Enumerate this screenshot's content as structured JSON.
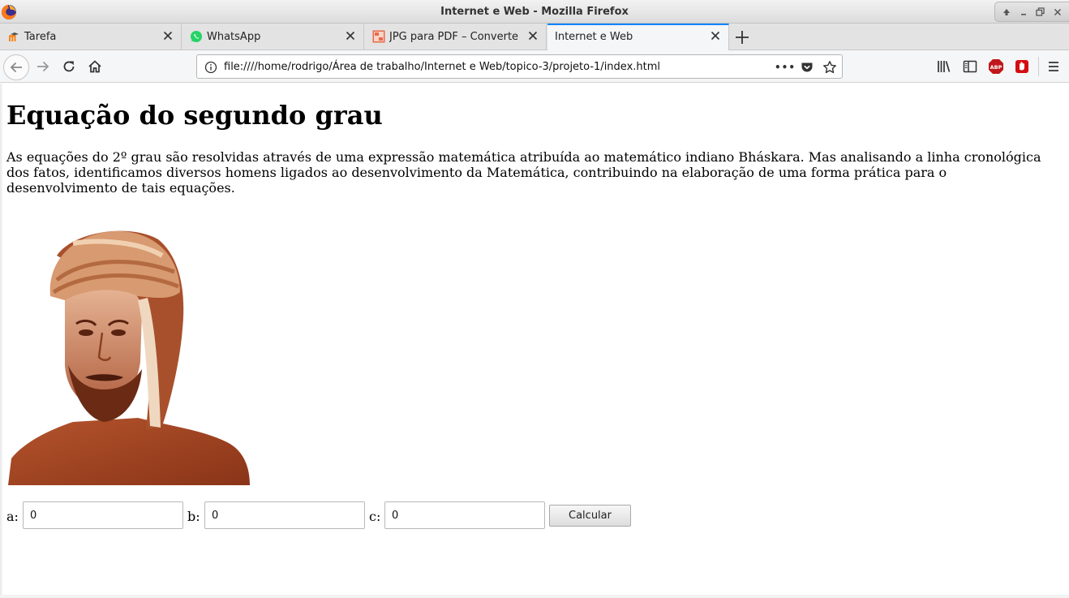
{
  "window": {
    "title": "Internet e Web - Mozilla Firefox"
  },
  "tabs": [
    {
      "label": "Tarefa",
      "icon": "moodle-icon"
    },
    {
      "label": "WhatsApp",
      "icon": "whatsapp-icon"
    },
    {
      "label": "JPG para PDF – Converter",
      "icon": "jpg-pdf-icon"
    },
    {
      "label": "Internet e Web",
      "icon": "",
      "active": true
    }
  ],
  "navbar": {
    "url": "file:////home/rodrigo/Área de trabalho/Internet e Web/topico-3/projeto-1/index.html",
    "more_label": "•••"
  },
  "page": {
    "heading": "Equação do segundo grau",
    "paragraph": "As equações do 2º grau são resolvidas através de uma expressão matemática atribuída ao matemático indiano Bháskara. Mas analisando a linha cronológica dos fatos, identificamos diversos homens ligados ao desenvolvimento da Matemática, contribuindo na elaboração de uma forma prática para o desenvolvimento de tais equações.",
    "image_subject": "portrait-illustration",
    "form": {
      "a_label": "a:",
      "a_value": "0",
      "b_label": "b:",
      "b_value": "0",
      "c_label": "c:",
      "c_value": "0",
      "submit_label": "Calcular"
    }
  },
  "colors": {
    "active_tab_accent": "#0a84ff",
    "abp_red": "#c0171c",
    "ext_red": "#d40d12",
    "firefox_orange": "#ff7a18"
  }
}
